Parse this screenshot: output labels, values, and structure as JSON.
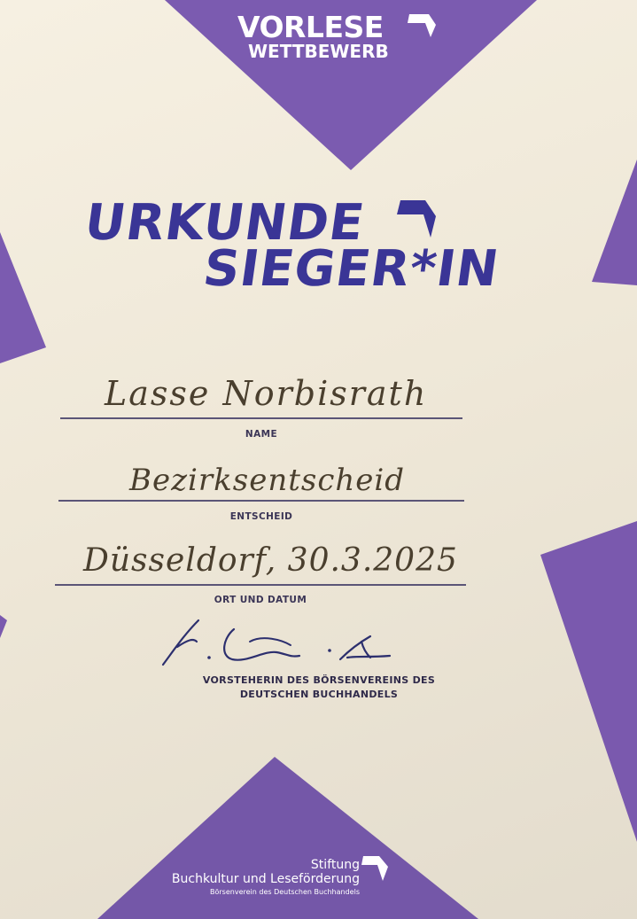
{
  "brand": {
    "line1": "VORLESE",
    "line2": "WETTBEWERB"
  },
  "title": {
    "line1": "URKUNDE",
    "line2": "SIEGER*IN"
  },
  "fields": [
    {
      "value": "Lasse Norbisrath",
      "label": "NAME"
    },
    {
      "value": "Bezirksentscheid",
      "label": "ENTSCHEID"
    },
    {
      "value": "Düsseldorf, 30.3.2025",
      "label": "ORT UND DATUM"
    }
  ],
  "signature": {
    "caption_line1": "VORSTEHERIN DES BÖRSENVEREINS DES",
    "caption_line2": "DEUTSCHEN BUCHHANDELS"
  },
  "foundation": {
    "line1": "Stiftung",
    "line2": "Buchkultur und Leseförderung",
    "line3": "Börsenverein des Deutschen Buchhandels"
  },
  "colors": {
    "purple": "#7b5bb0",
    "navy_title": "#3a3596",
    "paper": "#f3ecdd"
  },
  "icons": [
    "book-shape-icon"
  ]
}
